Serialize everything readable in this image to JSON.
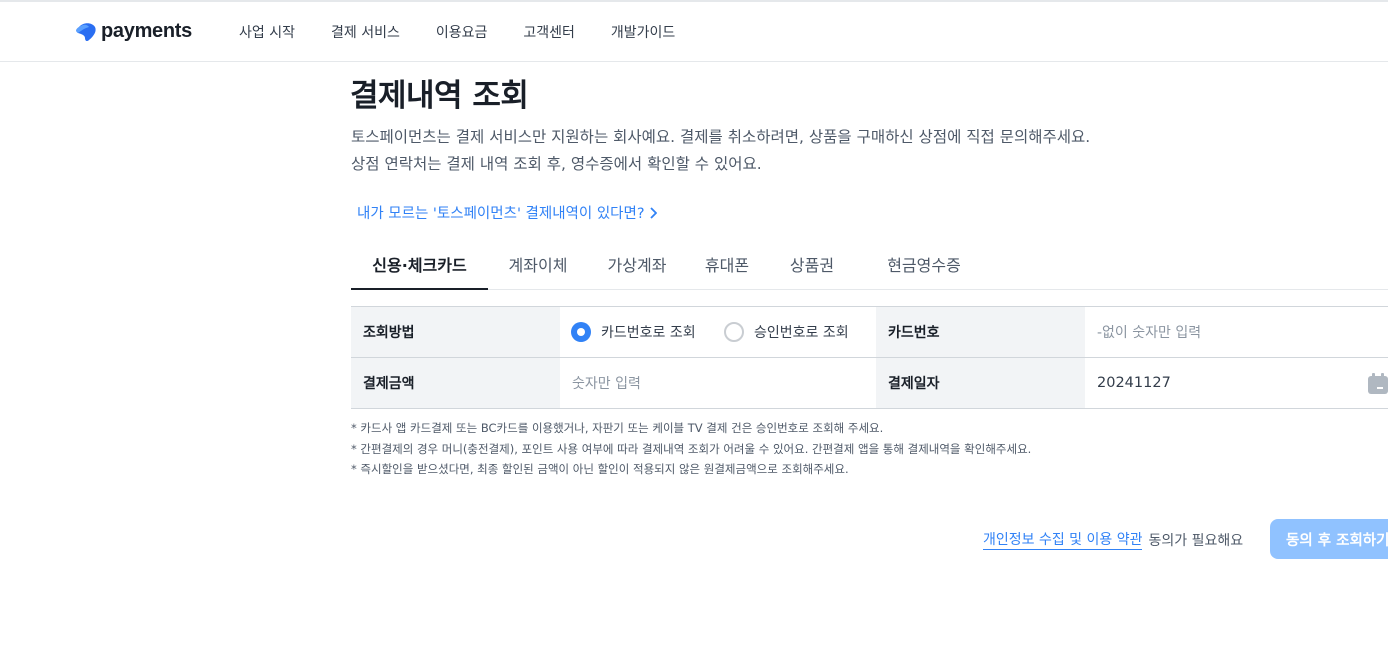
{
  "header": {
    "logo_text": "payments",
    "nav": [
      "사업 시작",
      "결제 서비스",
      "이용요금",
      "고객센터",
      "개발가이드"
    ]
  },
  "page": {
    "title": "결제내역 조회",
    "desc_line1": "토스페이먼츠는 결제 서비스만 지원하는 회사예요. 결제를 취소하려면, 상품을 구매하신 상점에 직접 문의해주세요.",
    "desc_line2": "상점 연락처는 결제 내역 조회 후, 영수증에서 확인할 수 있어요.",
    "help_link": "내가 모르는 '토스페이먼츠' 결제내역이 있다면?"
  },
  "tabs": [
    "신용·체크카드",
    "계좌이체",
    "가상계좌",
    "휴대폰",
    "상품권",
    "현금영수증"
  ],
  "active_tab": 0,
  "form": {
    "method_label": "조회방법",
    "radio_card": "카드번호로 조회",
    "radio_approval": "승인번호로 조회",
    "selected_method": "카드번호로 조회",
    "card_label": "카드번호",
    "card_placeholder": "-없이 숫자만 입력",
    "amount_label": "결제금액",
    "amount_placeholder": "숫자만 입력",
    "date_label": "결제일자",
    "date_value": "20241127"
  },
  "notes": [
    "* 카드사 앱 카드결제 또는 BC카드를 이용했거나, 자판기 또는 케이블 TV 결제 건은 승인번호로 조회해 주세요.",
    "* 간편결제의 경우 머니(충전결제), 포인트 사용 여부에 따라 결제내역 조회가 어려울 수 있어요. 간편결제 앱을 통해 결제내역을 확인해주세요.",
    "* 즉시할인을 받으셨다면, 최종 할인된 금액이 아닌 할인이 적용되지 않은 원결제금액으로 조회해주세요."
  ],
  "footer": {
    "terms_link": "개인정보 수집 및 이용 약관",
    "agree_text": "동의가 필요해요",
    "submit_label": "동의 후 조회하기"
  },
  "colors": {
    "accent": "#3182f6",
    "button_disabled": "#90c2ff",
    "label_bg": "#f2f4f6"
  }
}
